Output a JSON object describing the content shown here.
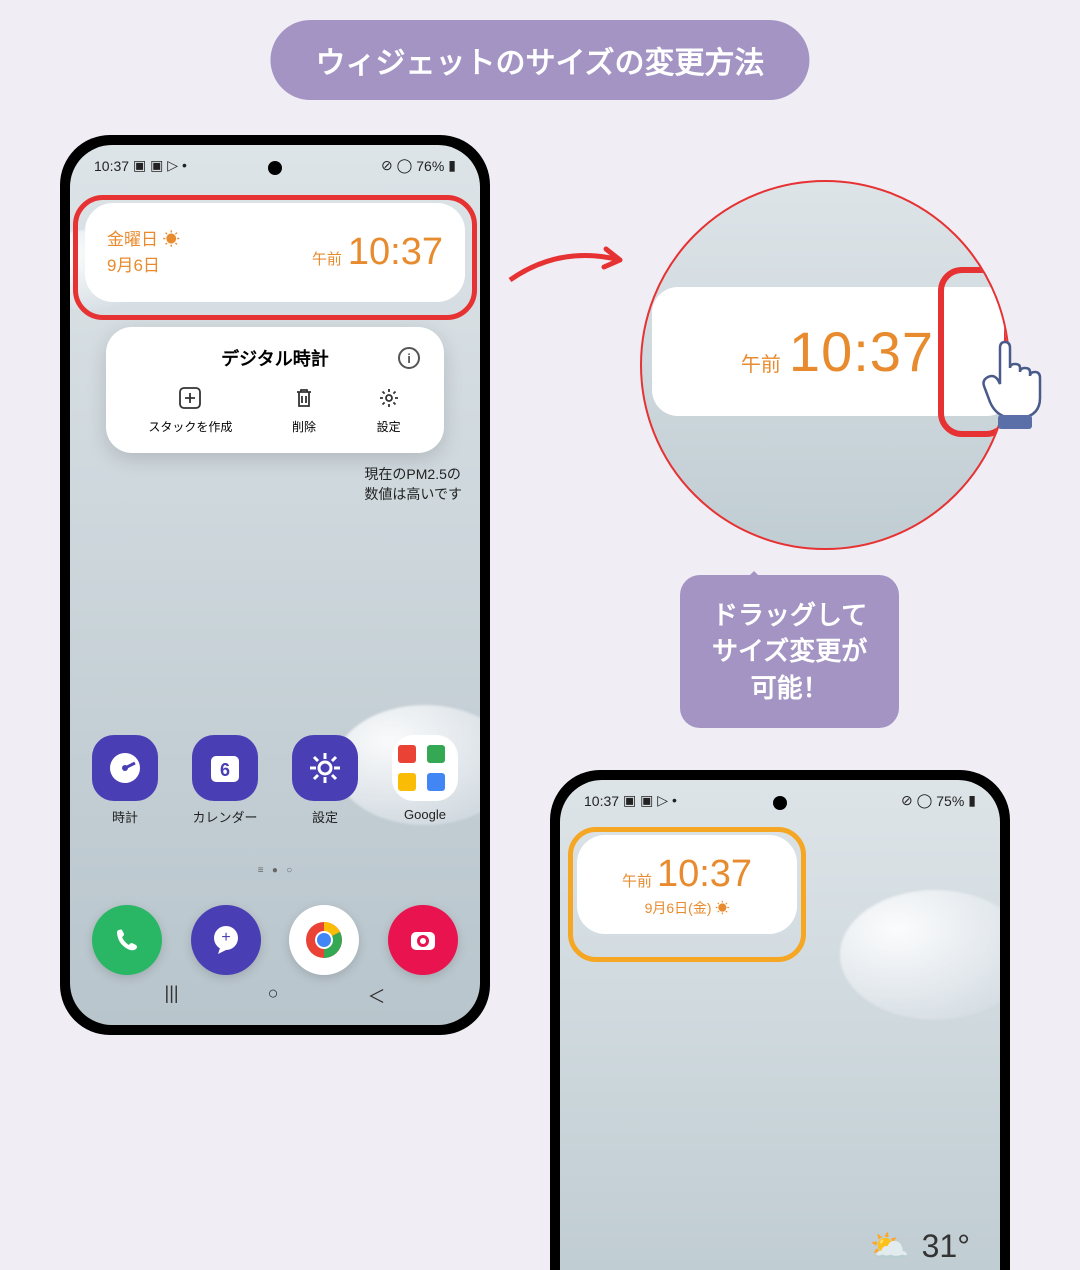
{
  "title": "ウィジェットのサイズの変更方法",
  "phone1": {
    "status": {
      "time": "10:37",
      "battery": "76%"
    },
    "widget": {
      "day": "金曜日 ☀",
      "date": "9月6日",
      "ampm": "午前",
      "time": "10:37"
    },
    "popup": {
      "title": "デジタル時計",
      "actions": {
        "stack": "スタックを作成",
        "delete": "削除",
        "settings": "設定"
      }
    },
    "pm25": {
      "line1": "現在のPM2.5の",
      "line2": "数値は高いです"
    },
    "apps": {
      "clock": "時計",
      "calendar": "カレンダー",
      "cal_num": "6",
      "settings": "設定",
      "google": "Google"
    }
  },
  "circle": {
    "ampm": "午前",
    "time": "10:37"
  },
  "bubble": {
    "line1": "ドラッグして",
    "line2": "サイズ変更が",
    "line3": "可能！"
  },
  "phone2": {
    "status": {
      "time": "10:37",
      "battery": "75%"
    },
    "widget": {
      "ampm": "午前",
      "time": "10:37",
      "date": "9月6日(金) ☀"
    },
    "weather": {
      "temp": "31°"
    }
  }
}
